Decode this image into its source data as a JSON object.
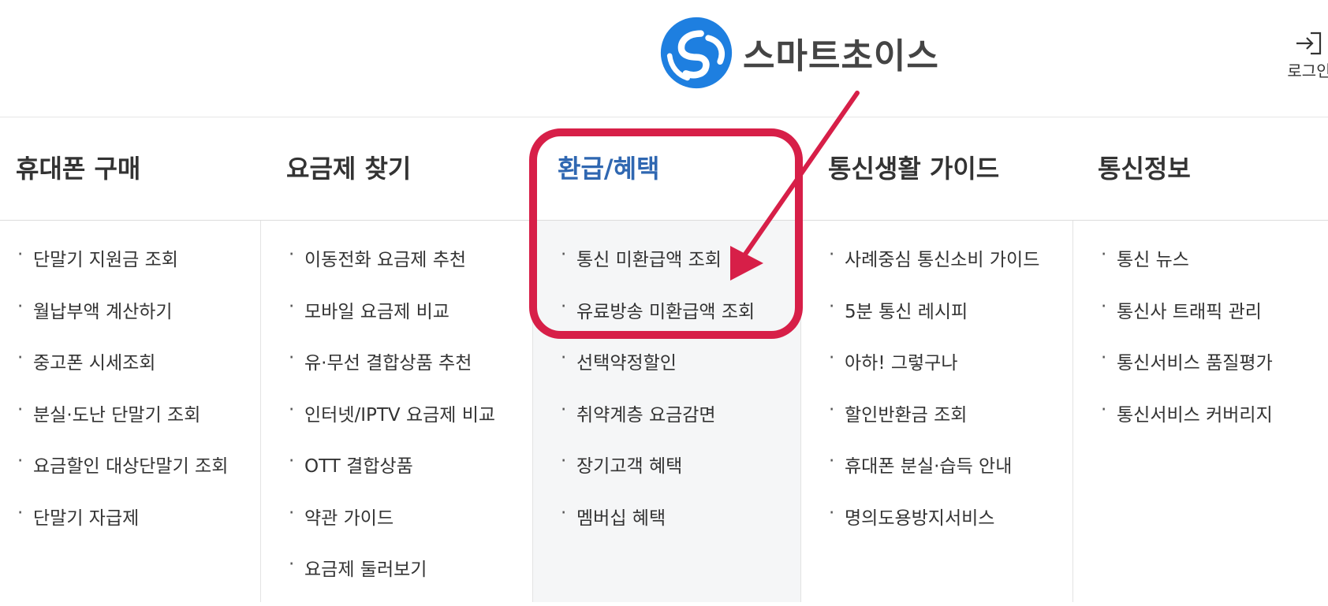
{
  "brand": {
    "name": "스마트초이스",
    "colors": {
      "logo_blue": "#1e7fe0",
      "text_gray": "#444444",
      "accent_blue": "#2f67b1",
      "callout_red": "#d71f48",
      "highlight_bg": "#f5f6f7"
    }
  },
  "header": {
    "login_label": "로그인",
    "login_icon": "login-arrow-icon"
  },
  "nav": {
    "items": [
      {
        "label": "휴대폰 구매"
      },
      {
        "label": "요금제 찾기"
      },
      {
        "label": "환급/혜택",
        "active": true
      },
      {
        "label": "통신생활 가이드"
      },
      {
        "label": "통신정보"
      }
    ]
  },
  "menu": {
    "columns": [
      {
        "items": [
          "단말기 지원금 조회",
          "월납부액 계산하기",
          "중고폰 시세조회",
          "분실·도난 단말기 조회",
          "요금할인 대상단말기 조회",
          "단말기 자급제"
        ]
      },
      {
        "items": [
          "이동전화 요금제 추천",
          "모바일 요금제 비교",
          "유·무선 결합상품 추천",
          "인터넷/IPTV 요금제 비교",
          "OTT 결합상품",
          "약관 가이드",
          "요금제 둘러보기"
        ]
      },
      {
        "items": [
          "통신 미환급액 조회",
          "유료방송 미환급액 조회",
          "선택약정할인",
          "취약계층 요금감면",
          "장기고객 혜택",
          "멤버십 혜택"
        ]
      },
      {
        "items": [
          "사례중심 통신소비 가이드",
          "5분 통신 레시피",
          "아하! 그렇구나",
          "할인반환금 조회",
          "휴대폰 분실·습득 안내",
          "명의도용방지서비스"
        ]
      },
      {
        "items": [
          "통신 뉴스",
          "통신사 트래픽 관리",
          "통신서비스 품질평가",
          "통신서비스 커버리지"
        ]
      }
    ],
    "bullet": "·"
  }
}
